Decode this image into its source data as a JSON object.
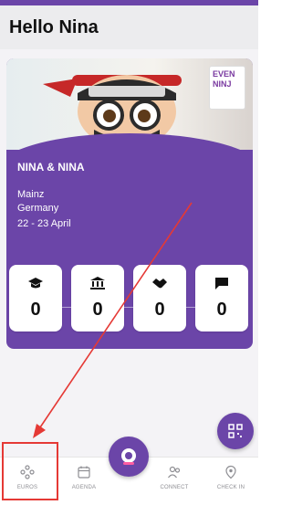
{
  "header": {
    "title": "Hello Nina"
  },
  "event": {
    "banner_text": "EVEN NINJ",
    "name": "NINA & NINA",
    "city": "Mainz",
    "country": "Germany",
    "dates": "22 - 23 April"
  },
  "stats": [
    {
      "icon": "graduation-cap-icon",
      "value": "0"
    },
    {
      "icon": "bank-icon",
      "value": "0"
    },
    {
      "icon": "handshake-icon",
      "value": "0"
    },
    {
      "icon": "chat-icon",
      "value": "0"
    }
  ],
  "nav": {
    "items": [
      {
        "label": "EUROS",
        "icon": "euros-icon"
      },
      {
        "label": "AGENDA",
        "icon": "calendar-icon"
      },
      {
        "label": "CONNECT",
        "icon": "people-icon"
      },
      {
        "label": "CHECK IN",
        "icon": "location-pin-icon"
      }
    ]
  },
  "colors": {
    "brand": "#6b45a8",
    "annotation": "#e53935"
  }
}
